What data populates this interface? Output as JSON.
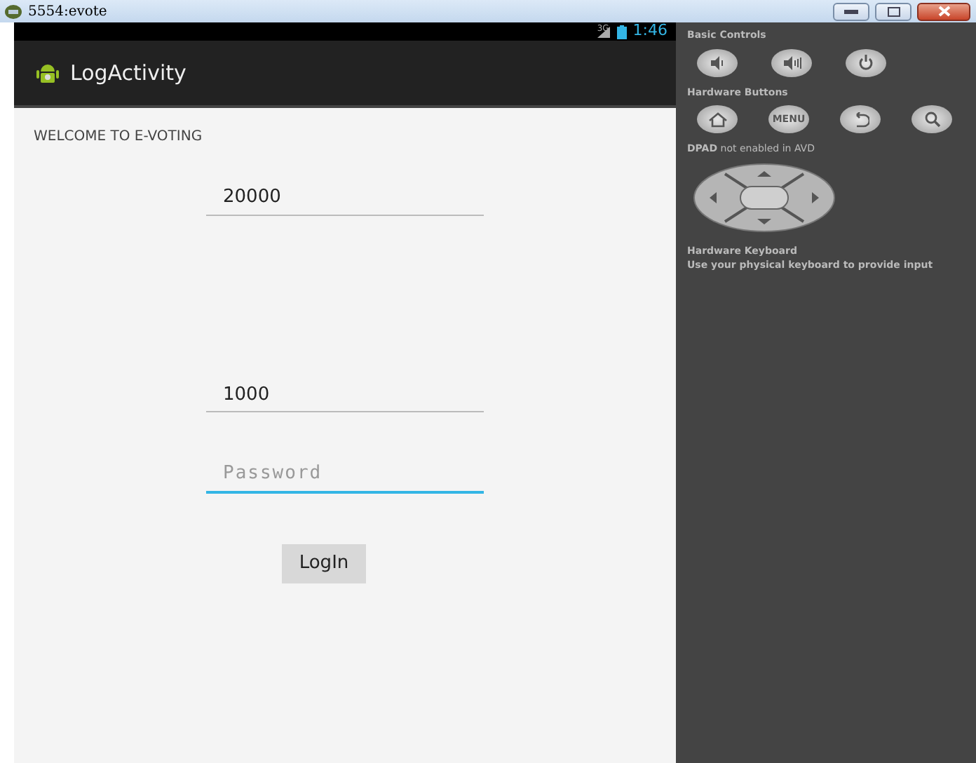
{
  "window": {
    "title": "5554:evote"
  },
  "status_bar": {
    "network": "3G",
    "time": "1:46"
  },
  "action_bar": {
    "title": "LogActivity"
  },
  "welcome": "WELCOME TO E-VOTING",
  "fields": [
    {
      "value": "20000",
      "focused": false
    },
    {
      "value": "1000",
      "focused": false
    },
    {
      "placeholder": "Password",
      "focused": true
    }
  ],
  "login_button": "LogIn",
  "controls": {
    "basic_title": "Basic Controls",
    "basic": [
      {
        "kind": "volume-down"
      },
      {
        "kind": "volume-up"
      },
      {
        "kind": "power"
      }
    ],
    "hardware_title": "Hardware Buttons",
    "hardware": [
      {
        "kind": "home"
      },
      {
        "kind": "menu",
        "label": "MENU"
      },
      {
        "kind": "back"
      },
      {
        "kind": "search"
      }
    ],
    "dpad_bold": "DPAD",
    "dpad_note": "not enabled in AVD",
    "keyboard_title": "Hardware Keyboard",
    "keyboard_note": "Use your physical keyboard to provide input"
  }
}
